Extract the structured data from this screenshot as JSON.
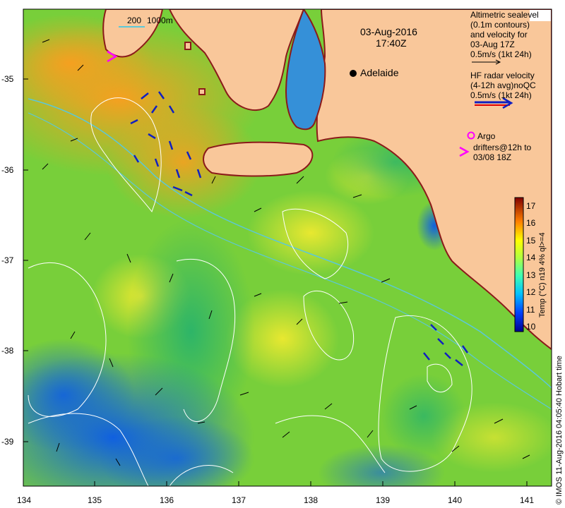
{
  "header": {
    "date": "03-Aug-2016",
    "time": "17:40Z"
  },
  "depth_legend": {
    "label_a": "200",
    "label_b": "1000m"
  },
  "city": {
    "name": "Adelaide"
  },
  "legend_altimetry": {
    "lines": [
      "Altimetric sealevel",
      "(0.1m contours)",
      "and velocity for",
      "03-Aug 17Z",
      "0.5m/s (1kt 24h)"
    ]
  },
  "legend_hf": {
    "lines": [
      "HF radar velocity",
      "(4-12h avg)noQC",
      "0.5m/s (1kt 24h)"
    ]
  },
  "legend_argo": {
    "lines": [
      "Argo",
      "drifters@12h to",
      "03/08 18Z"
    ]
  },
  "colorbar": {
    "title": "Temp (°C) n19 4% ql>=4",
    "ticks": [
      "17",
      "16",
      "15",
      "14",
      "13",
      "12",
      "11",
      "10"
    ]
  },
  "axes": {
    "y_ticks": [
      "-35",
      "-36",
      "-37",
      "-38",
      "-39"
    ],
    "x_ticks": [
      "134",
      "135",
      "136",
      "137",
      "138",
      "139",
      "140",
      "141"
    ]
  },
  "credit": "© IMOS 11-Aug-2016 04:05:40 Hobart time",
  "colors": {
    "land": "#f9c79a",
    "coast": "#8b1a1a",
    "contour": "#ffffff",
    "isobath": "#5bc8d8",
    "hf_vectors": "#1020c0",
    "argo": "#ff00ff"
  }
}
